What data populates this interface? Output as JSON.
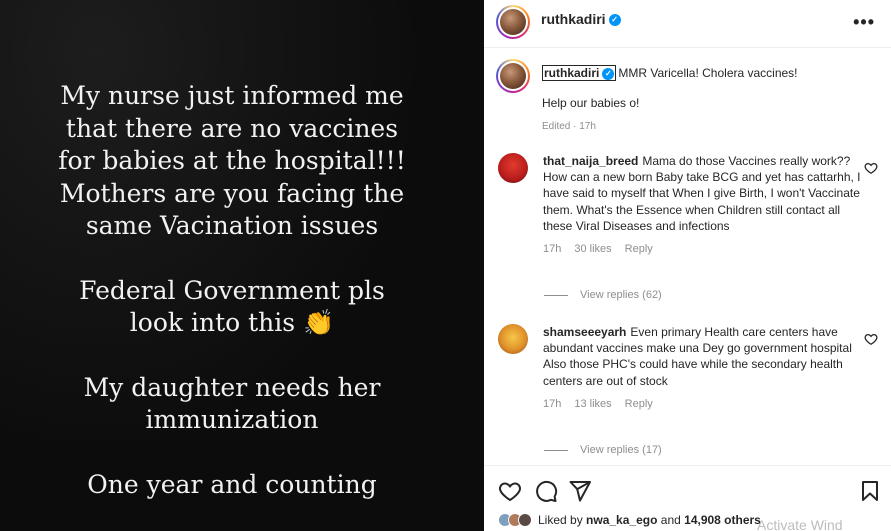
{
  "story": {
    "lines": [
      "My nurse just informed me",
      "that there are no vaccines",
      "for babies at the hospital!!!",
      "Mothers are you facing the",
      "same Vacination issues",
      "",
      "Federal Government pls",
      "look into this 👏",
      "",
      "My daughter needs her",
      "immunization",
      "",
      "One year and counting"
    ]
  },
  "post": {
    "username": "ruthkadiri",
    "more_label": "•••",
    "caption_user": "ruthkadiri",
    "caption_text": "MMR Varicella! Cholera vaccines!",
    "caption_text2": "Help our babies o!",
    "caption_meta": "Edited · 17h"
  },
  "comments": [
    {
      "user": "that_naija_breed",
      "text": "Mama do those Vaccines really work?? How can a new born Baby take BCG and yet has cattarhh, I have said to myself that When I give Birth, I won't Vaccinate them. What's the Essence when Children still contact all these Viral Diseases and infections",
      "time": "17h",
      "likes": "30 likes",
      "reply": "Reply",
      "view_replies": "View replies (62)"
    },
    {
      "user": "shamseeeyarh",
      "text": "Even primary Health care centers have abundant vaccines make una Dey go government hospital",
      "text2": "Also those PHC's could have while the secondary health centers are out of stock",
      "time": "17h",
      "likes": "13 likes",
      "reply": "Reply",
      "view_replies": "View replies (17)"
    }
  ],
  "likes_bar": {
    "prefix": "Liked by",
    "user": "nwa_ka_ego",
    "suffix": "and",
    "count": "14,908 others"
  },
  "watermark": "Activate Wind",
  "icons": [
    "heart-icon",
    "comment-icon",
    "share-icon",
    "bookmark-icon",
    "verified-icon",
    "more-icon"
  ],
  "colors": {
    "verified": "#0095f6",
    "muted": "#8e8e8e",
    "text": "#262626",
    "story_bg": "#0c0c0c"
  }
}
